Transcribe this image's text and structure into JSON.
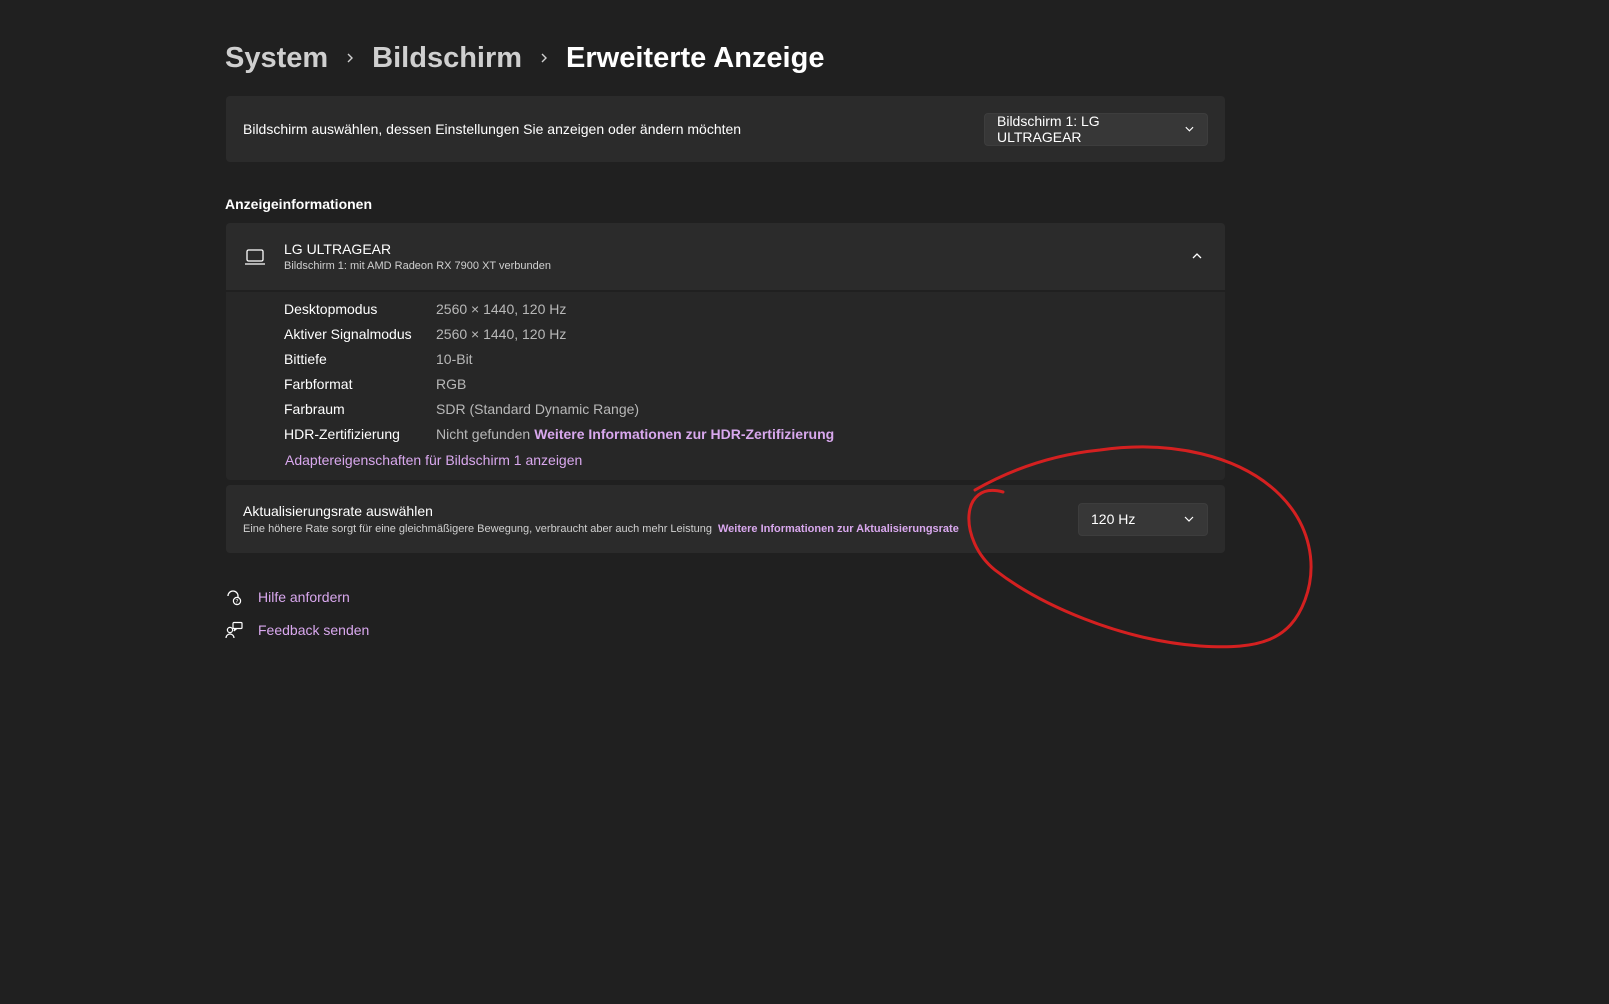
{
  "breadcrumb": {
    "items": [
      "System",
      "Bildschirm",
      "Erweiterte Anzeige"
    ]
  },
  "display_selector": {
    "label": "Bildschirm auswählen, dessen Einstellungen Sie anzeigen oder ändern möchten",
    "selected": "Bildschirm 1: LG ULTRAGEAR"
  },
  "display_info": {
    "section_title": "Anzeigeinformationen",
    "monitor_name": "LG ULTRAGEAR",
    "monitor_subtitle": "Bildschirm 1: mit AMD Radeon RX 7900 XT verbunden",
    "rows": [
      {
        "label": "Desktopmodus",
        "value": "2560 × 1440, 120 Hz"
      },
      {
        "label": "Aktiver Signalmodus",
        "value": "2560 × 1440, 120 Hz"
      },
      {
        "label": "Bittiefe",
        "value": "10-Bit"
      },
      {
        "label": "Farbformat",
        "value": "RGB"
      },
      {
        "label": "Farbraum",
        "value": "SDR (Standard Dynamic Range)"
      },
      {
        "label": "HDR-Zertifizierung",
        "value": "Nicht gefunden",
        "link": "Weitere Informationen zur HDR-Zertifizierung"
      }
    ],
    "adapter_link": "Adaptereigenschaften für Bildschirm 1 anzeigen"
  },
  "refresh_rate": {
    "title": "Aktualisierungsrate auswählen",
    "description": "Eine höhere Rate sorgt für eine gleichmäßigere Bewegung, verbraucht aber auch mehr Leistung",
    "link": "Weitere Informationen zur Aktualisierungsrate",
    "selected": "120 Hz"
  },
  "footer_links": {
    "help": "Hilfe anfordern",
    "feedback": "Feedback senden"
  },
  "colors": {
    "background": "#202020",
    "card": "#2b2b2b",
    "accent_link": "#d9a8ee",
    "annotation": "#d42020"
  },
  "icons": {
    "monitor": "laptop-icon",
    "collapse": "chevron-up-icon",
    "dropdown": "chevron-down-icon",
    "help": "help-chat-icon",
    "feedback": "feedback-icon"
  }
}
